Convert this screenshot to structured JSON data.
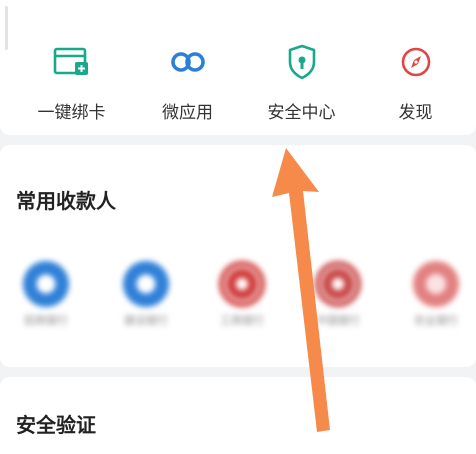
{
  "quick_actions": [
    {
      "label": "一键绑卡",
      "icon": "bind-card-icon",
      "color": "#17a98a"
    },
    {
      "label": "微应用",
      "icon": "mini-app-icon",
      "color": "#2b7fd8"
    },
    {
      "label": "安全中心",
      "icon": "shield-icon",
      "color": "#17a98a"
    },
    {
      "label": "发现",
      "icon": "compass-icon",
      "color": "#e24545"
    }
  ],
  "payees": {
    "title": "常用收款人",
    "items": [
      {
        "name": "招商银行",
        "color": "#2f80d8"
      },
      {
        "name": "建设银行",
        "color": "#2f80d8"
      },
      {
        "name": "工商银行",
        "color": "#d03a3a"
      },
      {
        "name": "中国银行",
        "color": "#c84545"
      },
      {
        "name": "农业银行",
        "color": "#e28080"
      }
    ]
  },
  "verify": {
    "title": "安全验证"
  },
  "colors": {
    "arrow": "#f58a4a"
  }
}
